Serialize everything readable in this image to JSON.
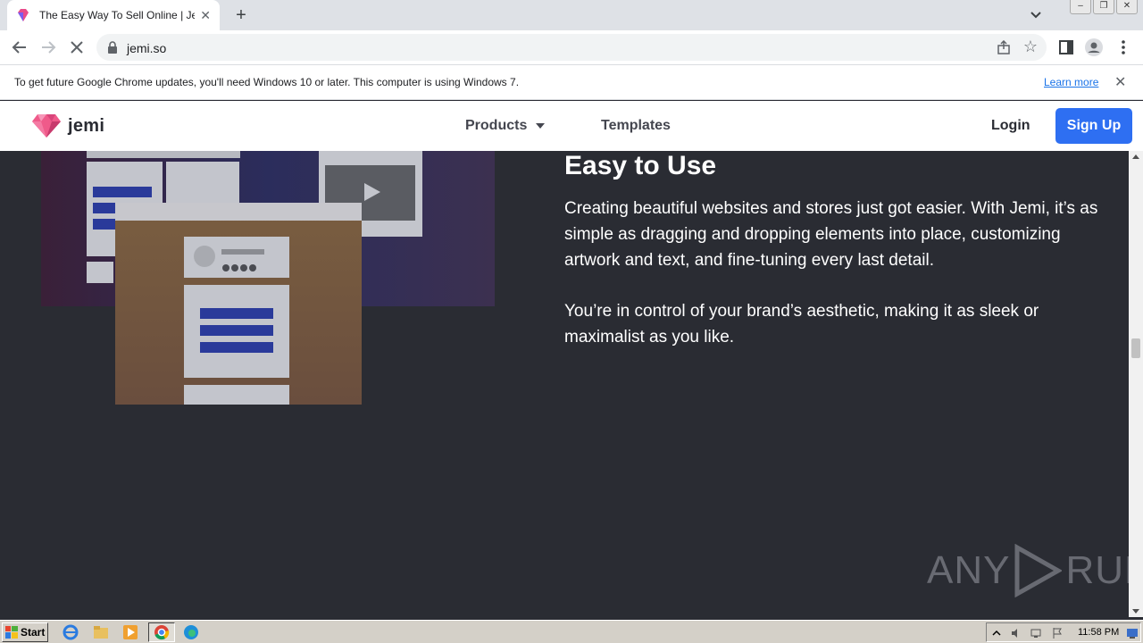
{
  "browser": {
    "tab": {
      "title": "The Easy Way To Sell Online | Jemi",
      "close_icon": "close-icon"
    },
    "new_tab": "+",
    "address": {
      "url": "jemi.so"
    },
    "window_buttons": [
      "–",
      "❐",
      "✕"
    ]
  },
  "infobar": {
    "message": "To get future Google Chrome updates, you'll need Windows 10 or later. This computer is using Windows 7.",
    "learn_more": "Learn more",
    "close": "✕"
  },
  "site": {
    "logo_text": "jemi",
    "nav": {
      "products": "Products",
      "templates": "Templates",
      "login": "Login",
      "signup": "Sign Up"
    },
    "colors": {
      "accent": "#2e6ff2",
      "background": "#2a2c33"
    }
  },
  "main": {
    "heading": "Easy to Use",
    "paragraph1": "Creating beautiful websites and stores just got easier. With Jemi, it’s as simple as dragging and dropping elements into place, customizing artwork and text, and fine-tuning every last detail.",
    "paragraph2": "You’re in control of your brand’s aesthetic, making it as sleek or maximalist as you like."
  },
  "watermark": {
    "left": "ANY",
    "right": "RUN"
  },
  "taskbar": {
    "start": "Start",
    "clock": "11:58 PM"
  }
}
